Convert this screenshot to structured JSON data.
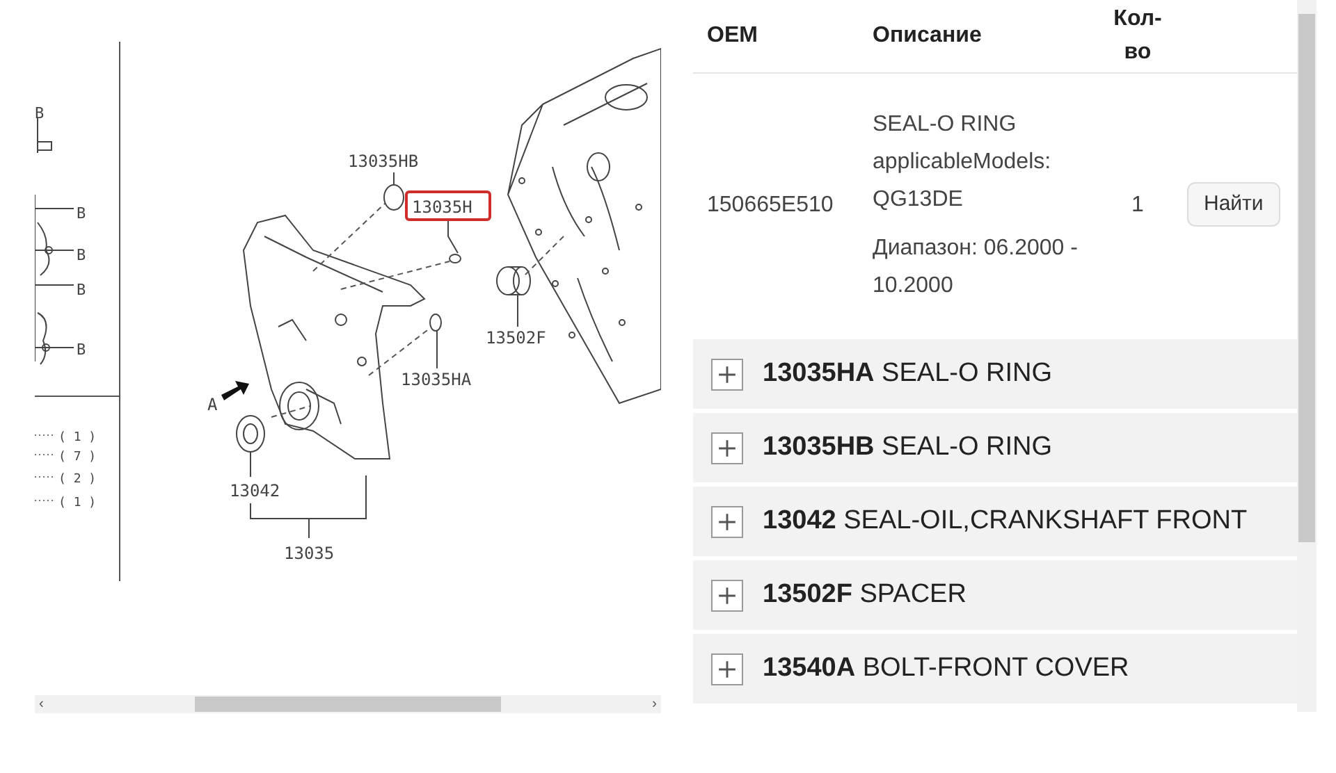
{
  "diagram": {
    "scroll_arrows": [
      "‹",
      "›"
    ],
    "side_marks": [
      "B",
      "B",
      "B",
      "B",
      "B"
    ],
    "quantities": [
      "( 1 )",
      "( 7 )",
      "( 2 )",
      "( 1 )"
    ],
    "callouts": [
      {
        "text": "13035HB",
        "highlighted": false
      },
      {
        "text": "13035H",
        "highlighted": true
      },
      {
        "text": "13502F",
        "highlighted": false
      },
      {
        "text": "13035HA",
        "highlighted": false
      },
      {
        "text": "A",
        "highlighted": false
      },
      {
        "text": "13042",
        "highlighted": false
      },
      {
        "text": "13035",
        "highlighted": false
      }
    ]
  },
  "table": {
    "columns": [
      "OEM",
      "Описание",
      "Кол-во"
    ],
    "row": {
      "oem": "150665E510",
      "description": "SEAL-O RING applicableModels: QG13DE",
      "range": "Диапазон: 06.2000 - 10.2000",
      "qty": "1",
      "button": "Найти"
    }
  },
  "parts": [
    {
      "code": "13035HA",
      "name": "SEAL-O RING",
      "expanded": false
    },
    {
      "code": "13035HB",
      "name": "SEAL-O RING",
      "expanded": false
    },
    {
      "code": "13042",
      "name": "SEAL-OIL,CRANKSHAFT FRONT",
      "expanded": false
    },
    {
      "code": "13502F",
      "name": "SPACER",
      "expanded": false
    },
    {
      "code": "13540A",
      "name": "BOLT-FRONT COVER",
      "expanded": false
    }
  ]
}
